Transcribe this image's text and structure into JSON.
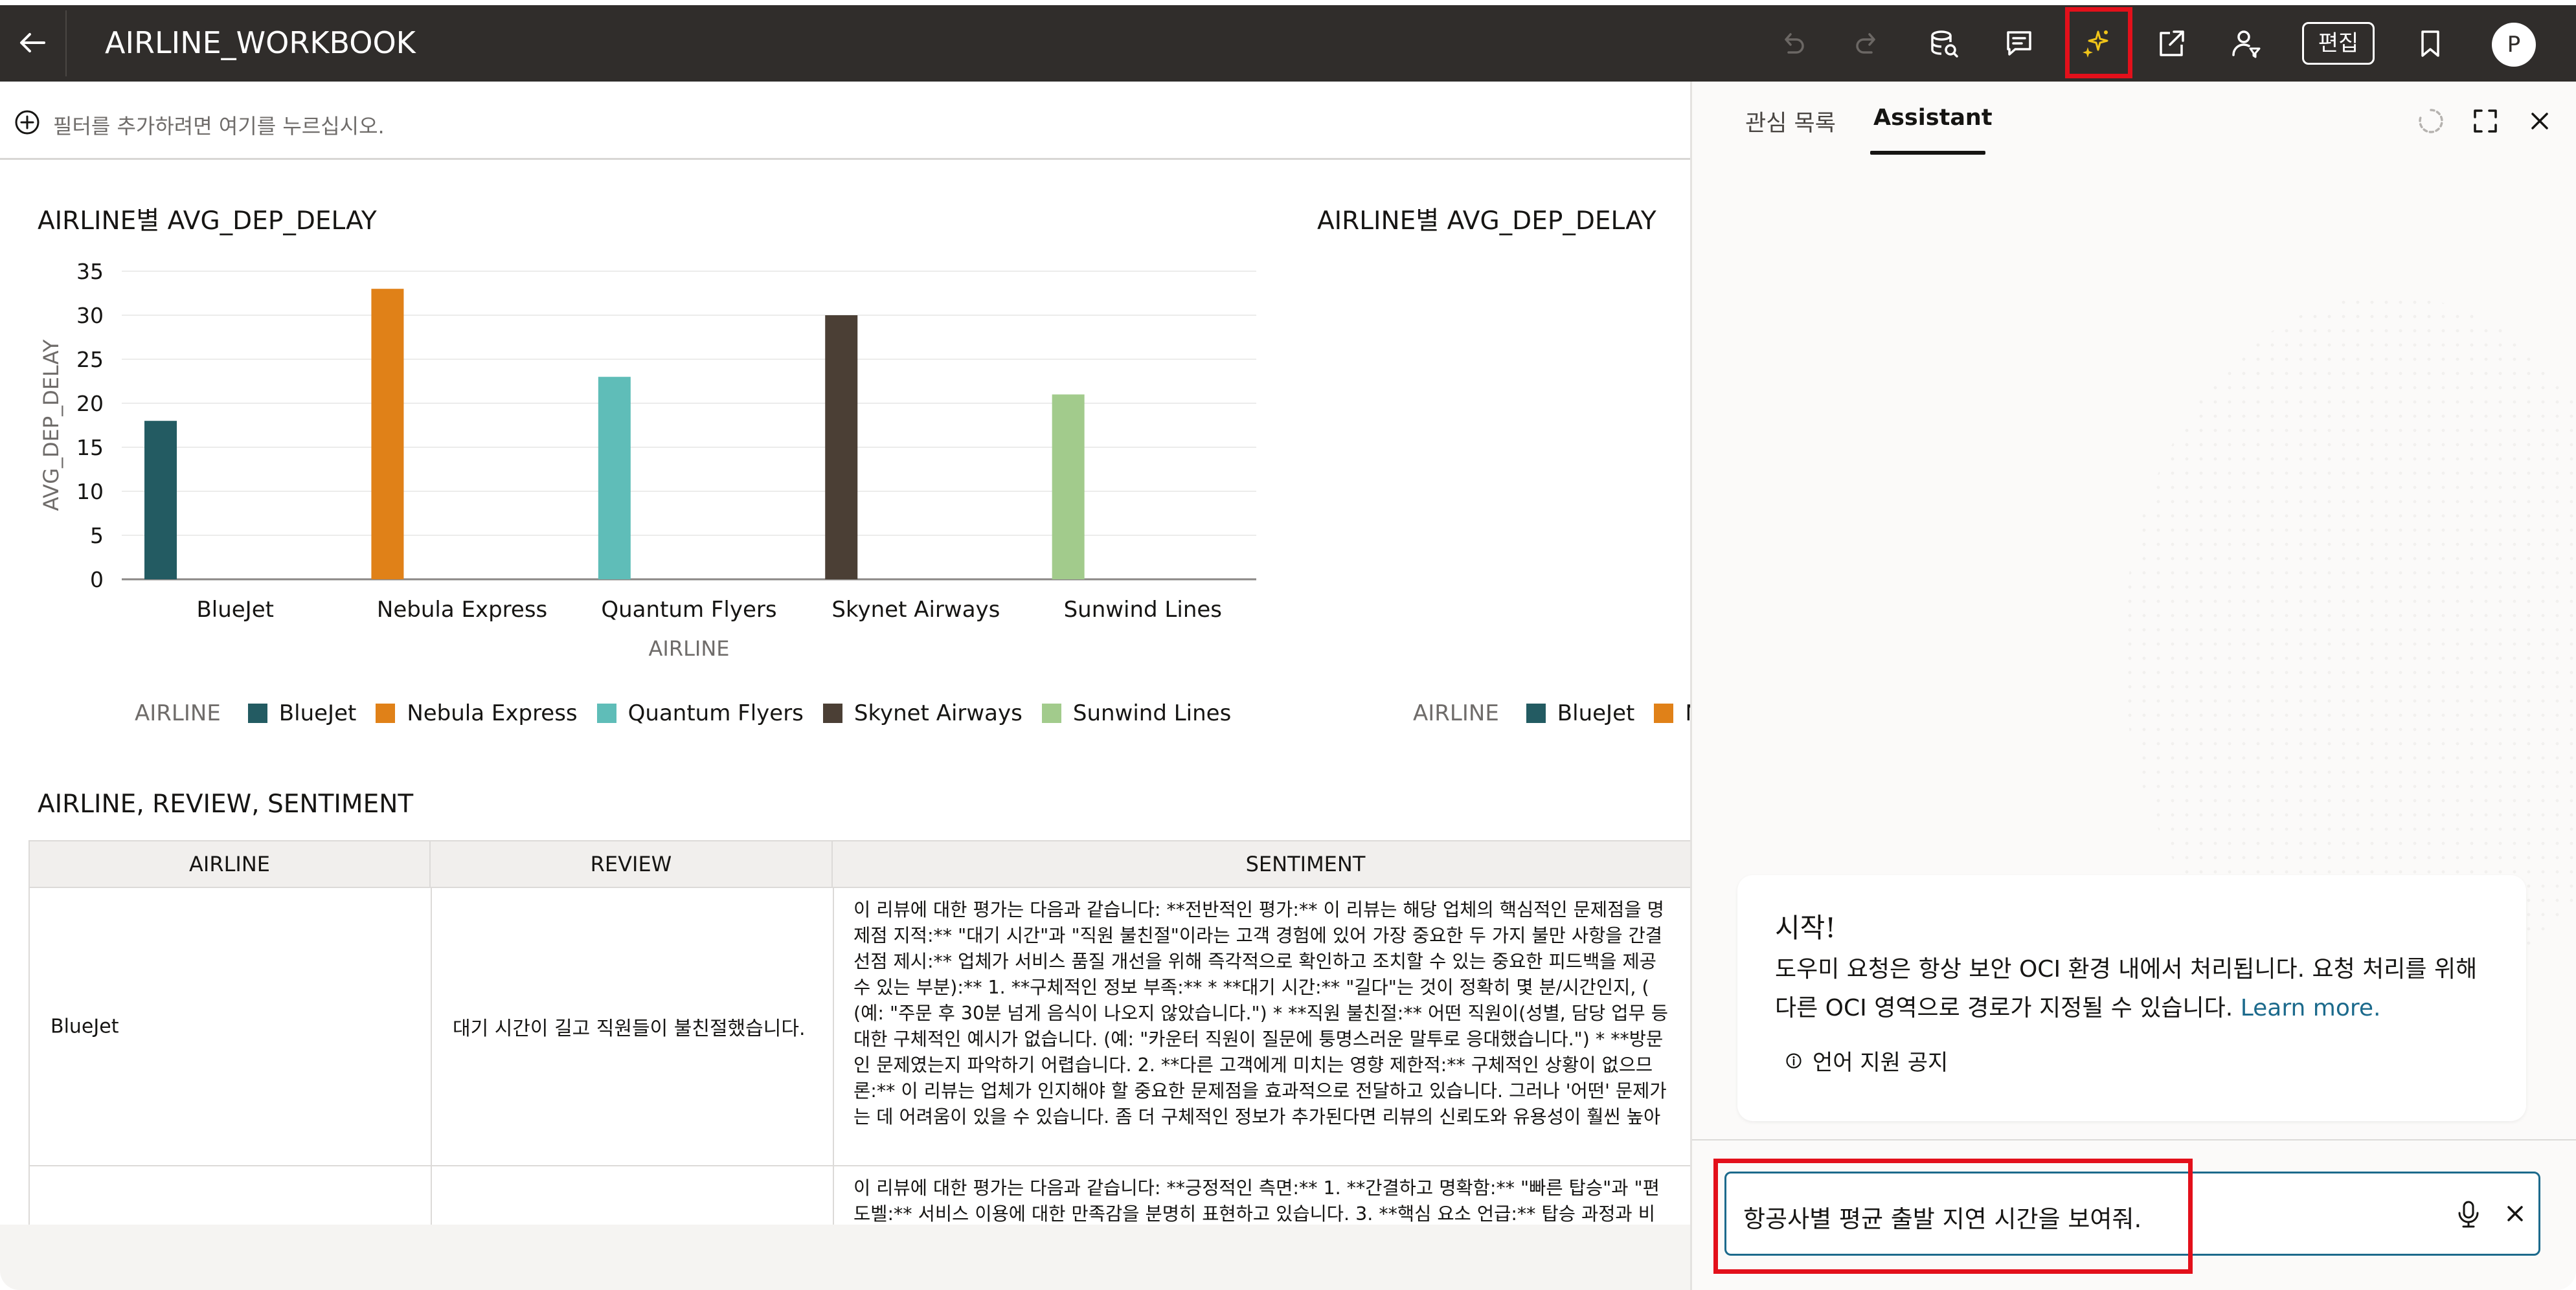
{
  "header": {
    "back_label": "Back",
    "title": "AIRLINE_WORKBOOK",
    "edit_label": "편집",
    "avatar_initial": "P",
    "icons": [
      "undo-icon",
      "redo-icon",
      "data-icon",
      "comment-icon",
      "assistant-sparkle-icon",
      "export-icon",
      "user-filter-icon",
      "bookmark-icon"
    ]
  },
  "filter_bar": {
    "placeholder": "필터를 추가하려면 여기를 누르십시오."
  },
  "charts": {
    "main_title": "AIRLINE별 AVG_DEP_DELAY",
    "second_title": "AIRLINE별 AVG_DEP_DELAY",
    "legend_title": "AIRLINE",
    "second_legend_title": "AIRLINE"
  },
  "chart_data": [
    {
      "type": "bar",
      "title": "AIRLINE별 AVG_DEP_DELAY",
      "xlabel": "AIRLINE",
      "ylabel": "AVG_DEP_DELAY",
      "categories": [
        "BlueJet",
        "Nebula Express",
        "Quantum Flyers",
        "Skynet Airways",
        "Sunwind Lines"
      ],
      "values": [
        18,
        33,
        23,
        30,
        21
      ],
      "colors": [
        "#235b62",
        "#e08118",
        "#5fbdb8",
        "#4b3f35",
        "#a2cb8c"
      ],
      "ylim": [
        0,
        35
      ],
      "yticks": [
        0,
        5,
        10,
        15,
        20,
        25,
        30,
        35
      ],
      "grid": true,
      "legend": "bottom-left"
    },
    {
      "type": "bar",
      "title": "AIRLINE별 AVG_DEP_DELAY",
      "categories": [
        "BlueJet",
        "N"
      ],
      "legend": "bottom-left"
    }
  ],
  "table": {
    "title": "AIRLINE, REVIEW, SENTIMENT",
    "columns": [
      "AIRLINE",
      "REVIEW",
      "SENTIMENT"
    ],
    "rows": [
      {
        "airline": "BlueJet",
        "review": "대기 시간이 길고 직원들이 불친절했습니다.",
        "sentiment_lines": [
          "이 리뷰에 대한 평가는 다음과 같습니다: **전반적인 평가:** 이 리뷰는 해당 업체의 핵심적인 문제점을 명",
          "제점 지적:** \"대기 시간\"과 \"직원 불친절\"이라는 고객 경험에 있어 가장 중요한 두 가지 불만 사항을 간결",
          "선점 제시:** 업체가 서비스 품질 개선을 위해 즉각적으로 확인하고 조치할 수 있는 중요한 피드백을 제공",
          "수 있는 부분):** 1. **구체적인 정보 부족:** * **대기 시간:** \"길다\"는 것이 정확히 몇 분/시간인지, (",
          "(예: \"주문 후 30분 넘게 음식이 나오지 않았습니다.\") * **직원 불친절:** 어떤 직원이(성별, 담당 업무 등",
          "대한 구체적인 예시가 없습니다. (예: \"카운터 직원이 질문에 퉁명스러운 말투로 응대했습니다.\") * **방문",
          "인 문제였는지 파악하기 어렵습니다. 2. **다른 고객에게 미치는 영향 제한적:** 구체적인 상황이 없으므",
          "론:** 이 리뷰는 업체가 인지해야 할 중요한 문제점을 효과적으로 전달하고 있습니다. 그러나 '어떤' 문제가",
          "는 데 어려움이 있을 수 있습니다. 좀 더 구체적인 정보가 추가된다면 리뷰의 신뢰도와 유용성이 훨씬 높아"
        ]
      },
      {
        "airline": "",
        "review": "",
        "sentiment_lines": [
          "이 리뷰에 대한 평가는 다음과 같습니다: **긍정적인 측면:** 1. **간결하고 명확함:** \"빠른 탑승\"과 \"편",
          "도벨:** 서비스 이용에 대한 만족감을 분명히 표현하고 있습니다. 3. **핵심 요소 언급:** 탑승 과정과 비"
        ]
      }
    ]
  },
  "assistant": {
    "tab_watchlist": "관심 목록",
    "tab_assistant": "Assistant",
    "welcome_heading": "시작!",
    "welcome_body": "도우미 요청은 항상 보안 OCI 환경 내에서 처리됩니다. 요청 처리를 위해 다른 OCI 영역으로 경로가 지정될 수 있습니다. ",
    "learn_more": "Learn more.",
    "language_notice": "언어 지원 공지",
    "prompt_value": "항공사별 평균 출발 지연 시간을 보여줘."
  },
  "colors": {
    "header_bg": "#302d2b",
    "highlight": "#e3101b",
    "accent": "#1c6a8c"
  }
}
